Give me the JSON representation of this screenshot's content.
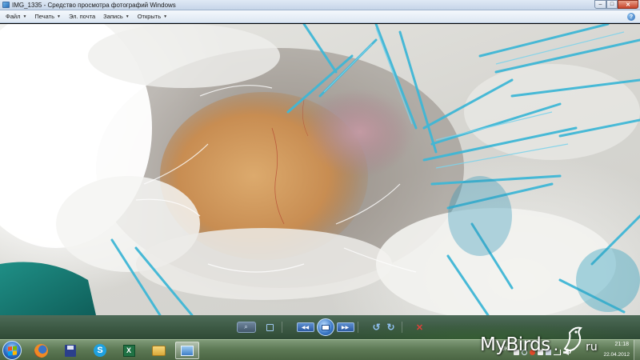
{
  "window": {
    "title": "IMG_1335 - Средство просмотра фотографий Windows",
    "controls": {
      "minimize": "–",
      "maximize": "□",
      "close": "✕"
    }
  },
  "menu": {
    "items": [
      {
        "label": "Файл",
        "has_dropdown": true
      },
      {
        "label": "Печать",
        "has_dropdown": true
      },
      {
        "label": "Эл. почта",
        "has_dropdown": false
      },
      {
        "label": "Запись",
        "has_dropdown": true
      },
      {
        "label": "Открыть",
        "has_dropdown": true
      }
    ],
    "dropdown_glyph": "▼",
    "help_glyph": "?"
  },
  "viewer": {
    "image": "close-up photo of bird skin with blue and white feathers",
    "controls": {
      "zoom_glyph": "⌕",
      "prev_glyph": "◀◀",
      "next_glyph": "▶▶",
      "rotate_left_glyph": "↺",
      "rotate_right_glyph": "↻",
      "delete_glyph": "✕"
    }
  },
  "taskbar": {
    "apps": [
      {
        "name": "firefox",
        "active": false
      },
      {
        "name": "save",
        "active": false
      },
      {
        "name": "skype",
        "active": false,
        "glyph": "S"
      },
      {
        "name": "excel",
        "active": false,
        "glyph": "X"
      },
      {
        "name": "folder",
        "active": false
      },
      {
        "name": "photo-viewer",
        "active": true
      }
    ],
    "tray": {
      "language": "UK",
      "time": "21:18",
      "date": "22.04.2012"
    }
  },
  "watermark": {
    "text": "MyBirds",
    "dot": ".",
    "tld": "ru"
  },
  "colors": {
    "feather_blue": "#3fb7d6",
    "taskbar": "#5e7a56",
    "title_bar": "#dfe9f5"
  }
}
